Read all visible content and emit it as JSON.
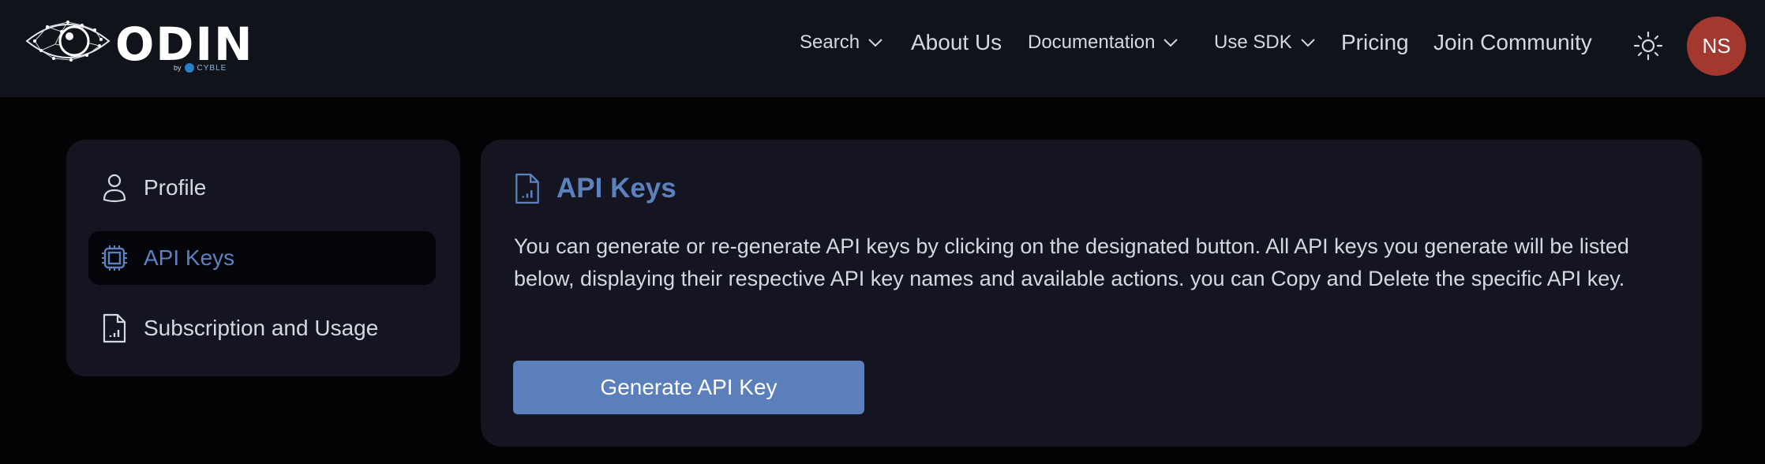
{
  "brand": {
    "name": "ODIN",
    "by": "by",
    "company": "CYBLE"
  },
  "nav": {
    "items": [
      {
        "label": "Search",
        "dropdown": true
      },
      {
        "label": "About Us",
        "dropdown": false
      },
      {
        "label": "Documentation",
        "dropdown": true
      },
      {
        "label": "Use SDK",
        "dropdown": true
      },
      {
        "label": "Pricing",
        "dropdown": false
      },
      {
        "label": "Join Community",
        "dropdown": false
      }
    ],
    "theme_icon": "sun-icon",
    "avatar_initials": "NS"
  },
  "sidebar": {
    "items": [
      {
        "label": "Profile",
        "icon": "user-icon",
        "active": false
      },
      {
        "label": "API Keys",
        "icon": "chip-icon",
        "active": true
      },
      {
        "label": "Subscription and Usage",
        "icon": "file-chart-icon",
        "active": false
      }
    ]
  },
  "main": {
    "title": "API Keys",
    "title_icon": "file-chart-icon",
    "description": "You can generate or re-generate API keys by clicking on the designated button. All API keys you generate will be listed below, displaying their respective API key names and available actions. you can Copy and Delete the specific API key.",
    "generate_button": "Generate API Key"
  },
  "colors": {
    "accent": "#5b82bd",
    "button": "#5b7fba",
    "avatar": "#a2382e",
    "header_bg": "#11131b",
    "card_bg": "#141520",
    "page_bg": "#030305"
  }
}
